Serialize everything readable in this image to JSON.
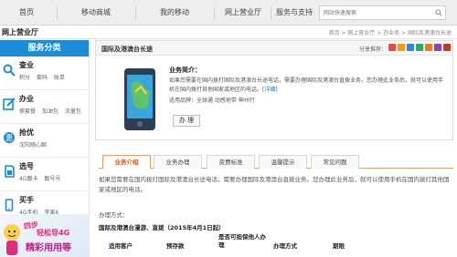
{
  "top_nav": {
    "items": [
      "首页",
      "移动商城",
      "我的移动",
      "网上营业厅",
      "服务与支持"
    ],
    "search_placeholder": "网站快速搜索"
  },
  "sub_bar": {
    "hall_title": "网上营业厅",
    "breadcrumb": "首页 > 网上营业厅 > 办业务 > 国际及港澳台长途"
  },
  "sidebar": {
    "title": "服务分类",
    "categories": [
      {
        "title": "查业",
        "links": [
          "积分",
          "套码",
          "账单"
        ]
      },
      {
        "title": "办业",
        "links": [
          "换套餐",
          "加油包",
          "流量包"
        ]
      },
      {
        "title": "抢优",
        "links": [
          "沈阳随心聊"
        ]
      },
      {
        "title": "选号",
        "links": [
          "4G靓卡",
          "靓号号"
        ]
      },
      {
        "title": "买手",
        "links": [
          "4G手机",
          "苹果6"
        ]
      }
    ],
    "banner": {
      "line1": "四步",
      "line2": "轻松导4G",
      "line3": "精彩用用等"
    }
  },
  "product": {
    "title": "国际及港澳台长途",
    "share_label": "分享推荐：",
    "intro_title": "业务简介：",
    "intro_text": "如果您需要在国内拨打国际及港澳台长途电话，需要办理国际及港澳台直拨业务。您办理此业务后，就可以使用手机在国内拨打其他国家或地区的电话。",
    "detail_link": "[详细]",
    "range_label": "适用品牌：全球通 动感地带 神州行",
    "subscribe_button": "办 理"
  },
  "tabs": {
    "items": [
      "业务介绍",
      "业务办理",
      "资费标准",
      "温馨提示",
      "常见问题"
    ],
    "active_index": 0
  },
  "content": {
    "description": "如果您需要在国内拨打国际及港澳台长途电话，需要办理国际及港澳台直拨业务。您办理此业务后，就可以使用手机在国内拨打其他国家或地区的电话。",
    "way_label": "办理方式：",
    "bold_line": "国际及港澳台漫游、直拨（2015年4月1日起）",
    "table_headers": [
      "适用客户",
      "预存款",
      "是否可担保他人办理",
      "办理方式",
      "期限"
    ]
  }
}
